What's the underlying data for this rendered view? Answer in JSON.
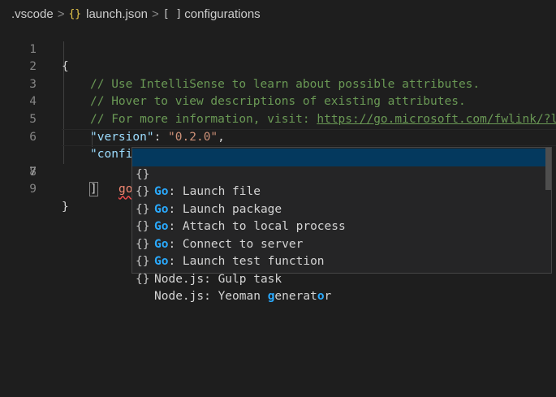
{
  "breadcrumb": {
    "folder": ".vscode",
    "file_icon": "{}",
    "file": "launch.json",
    "symbol_icon": "[ ]",
    "symbol": "configurations",
    "separator": ">"
  },
  "editor": {
    "lines": [
      {
        "n": "1"
      },
      {
        "n": "2",
        "text": "// Use IntelliSense to learn about possible attributes."
      },
      {
        "n": "3",
        "text": "// Hover to view descriptions of existing attributes."
      },
      {
        "n": "4",
        "text": "// For more information, visit: ",
        "link": "https://go.microsoft.com/fwlink/?li"
      },
      {
        "n": "5",
        "key": "\"version\"",
        "value": "\"0.2.0\""
      },
      {
        "n": "6",
        "key": "\"configurations\""
      },
      {
        "n": "7",
        "typed": "go"
      },
      {
        "n": "8"
      },
      {
        "n": "9"
      }
    ],
    "open_brace": "{",
    "close_brace": "}",
    "open_bracket": "[",
    "close_bracket": "]",
    "colon": ": ",
    "comma": ","
  },
  "suggestions": {
    "icon": "{}",
    "items": [
      {
        "prefix": "Go",
        "rest": ": Launch file"
      },
      {
        "prefix": "Go",
        "rest": ": Launch package"
      },
      {
        "prefix": "Go",
        "rest": ": Attach to local process"
      },
      {
        "prefix": "Go",
        "rest": ": Connect to server"
      },
      {
        "prefix": "Go",
        "rest": ": Launch test function"
      },
      {
        "text": "Node.js: Gulp task"
      },
      {
        "text_a": "Node.js: Yeoman ",
        "hl_a": "g",
        "text_b": "enerat",
        "hl_b": "o",
        "text_c": "r"
      }
    ],
    "selected_index": 0
  },
  "colors": {
    "background": "#1e1e1e",
    "comment": "#6a9955",
    "key": "#9cdcfe",
    "string": "#ce9178",
    "match_highlight": "#2aaaff",
    "selected_bg": "#04395e"
  }
}
